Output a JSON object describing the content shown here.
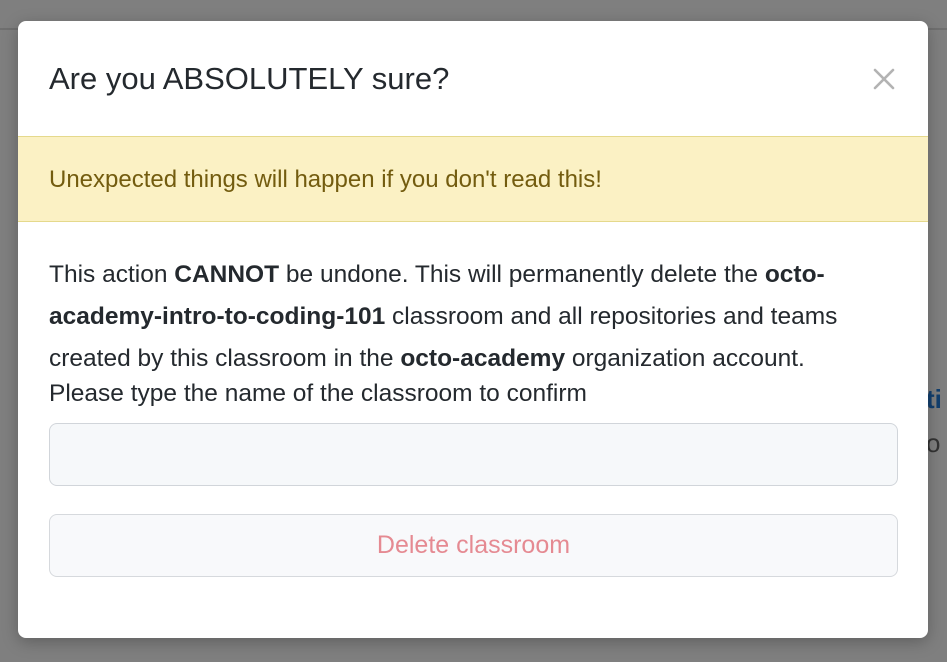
{
  "background": {
    "partial_link_text": "ti",
    "partial_text": "o"
  },
  "dialog": {
    "title": "Are you ABSOLUTELY sure?",
    "close_icon": "close-x-icon",
    "warning": "Unexpected things will happen if you don't read this!",
    "body": {
      "part1": "This action ",
      "cannot": "CANNOT",
      "part2": " be undone. This will permanently delete the ",
      "classroom_name": "octo-academy-intro-to-coding-101",
      "part3": " classroom and all repositories and teams created by this classroom in the ",
      "org_name": "octo-academy",
      "part4": " organization account."
    },
    "confirm_label": "Please type the name of the classroom to confirm",
    "confirm_input": {
      "value": "",
      "placeholder": ""
    },
    "delete_button_label": "Delete classroom"
  },
  "colors": {
    "warning_bg": "#fbf1c4",
    "warning_text": "#735c0f",
    "danger_text_disabled": "#e58a92",
    "overlay": "#7d7d7d"
  }
}
